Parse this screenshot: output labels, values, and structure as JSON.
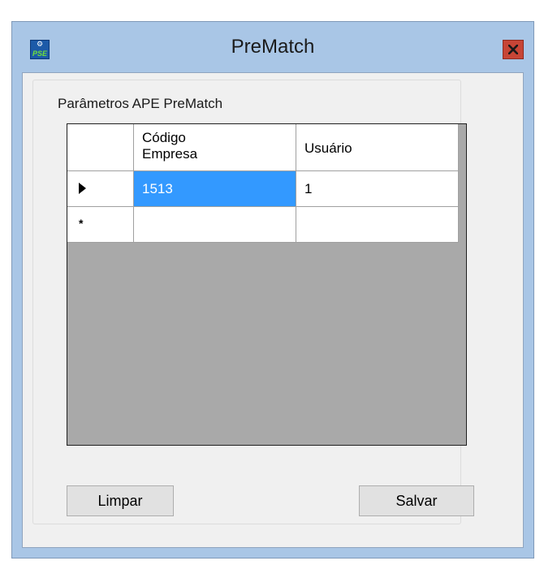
{
  "window": {
    "title": "PreMatch",
    "app_icon_text": "PSE",
    "close_icon": "close-icon",
    "accent_color": "#a9c6e6",
    "close_color": "#c74536"
  },
  "group": {
    "label": "Parâmetros APE PreMatch"
  },
  "grid": {
    "columns": [
      "Código Empresa",
      "Usuário"
    ],
    "rows": [
      {
        "indicator": "current-row-arrow",
        "codigo_empresa": "1513",
        "usuario": "1"
      },
      {
        "indicator": "*",
        "codigo_empresa": "",
        "usuario": ""
      }
    ],
    "selected_color": "#3399ff"
  },
  "buttons": {
    "limpar": "Limpar",
    "salvar": "Salvar"
  }
}
